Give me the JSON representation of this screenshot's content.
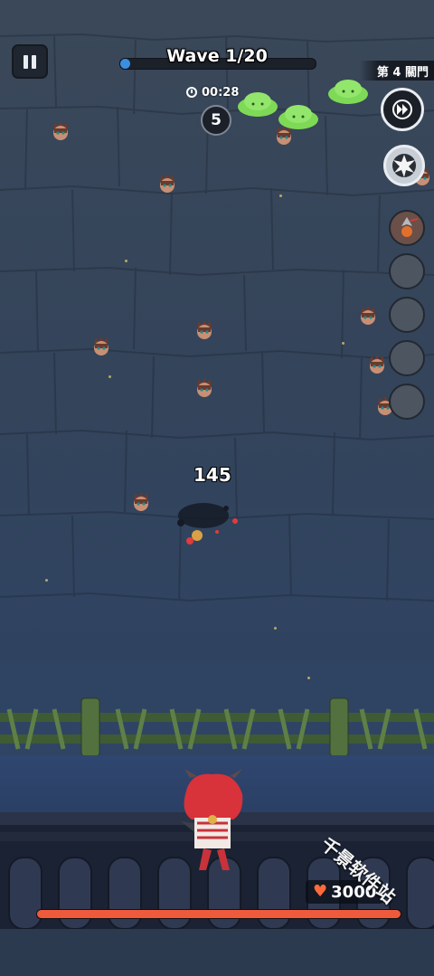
{
  "hud": {
    "wave_label": "Wave 1/20",
    "wave_progress": 0.05,
    "timer": "00:28",
    "counter": "5",
    "gate_label": "第 4 關門",
    "fast_forward_icon": "fast-forward-icon",
    "skill_icon": "explosion-skill-icon",
    "pause_icon": "pause-icon"
  },
  "battle": {
    "damage_number": "145"
  },
  "player": {
    "hp_value": "3000",
    "hp_progress": 1.0,
    "heart_icon": "heart-icon"
  },
  "watermark": {
    "text": "千景软件站"
  },
  "colors": {
    "wave_fill": "#3a8fe0",
    "hp_fill": "#ef5a3c",
    "slime": "#7ed957"
  }
}
